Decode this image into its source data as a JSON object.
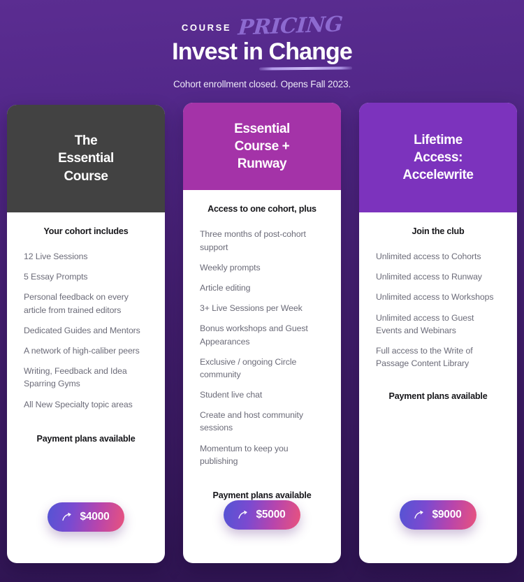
{
  "header": {
    "eyebrow_primary": "COURSE",
    "eyebrow_script": "PRICING",
    "headline": "Invest in Change",
    "subtitle": "Cohort enrollment closed. Opens Fall 2023.",
    "underline_color": "#b49ceb"
  },
  "theme": {
    "background_top": "#5b2d91",
    "background_bottom": "#2e1450",
    "cta_gradient_start": "#5454d4",
    "cta_gradient_end": "#e9537d",
    "card_body_bg": "#ffffff",
    "feature_text_color": "#6b6b78"
  },
  "plans": [
    {
      "title": "The Essential Course",
      "title_lines": [
        "The",
        "Essential",
        "Course"
      ],
      "header_color": "#424242",
      "subhead": "Your cohort includes",
      "features": [
        "12 Live Sessions",
        "5 Essay Prompts",
        "Personal feedback on every article from trained editors",
        "Dedicated Guides and Mentors",
        "A network of high-caliber peers",
        "Writing, Feedback and Idea Sparring Gyms",
        "All New Specialty topic areas"
      ],
      "payment_note": "Payment plans available",
      "price_label": "$4000",
      "cta_icon": "curved-arrow-icon"
    },
    {
      "title": "Essential Course + Runway",
      "title_lines": [
        "Essential",
        "Course +",
        "Runway"
      ],
      "header_color": "#a433a8",
      "subhead": "Access to one cohort, plus",
      "features": [
        "Three months of post-cohort support",
        "Weekly prompts",
        "Article editing",
        "3+ Live Sessions per Week",
        "Bonus workshops and Guest Appearances",
        "Exclusive / ongoing Circle community",
        "Student live chat",
        "Create and host community sessions",
        "Momentum to keep you publishing"
      ],
      "payment_note": "Payment plans available",
      "price_label": "$5000",
      "cta_icon": "curved-arrow-icon"
    },
    {
      "title": "Lifetime Access: Accelewrite",
      "title_lines": [
        "Lifetime",
        "Access:",
        "Accelewrite"
      ],
      "header_color": "#7c33bd",
      "subhead": "Join the club",
      "features": [
        "Unlimited access to Cohorts",
        "Unlimited access to Runway",
        "Unlimited access to Workshops",
        "Unlimited access to Guest Events and Webinars",
        "Full access to the Write of Passage Content Library"
      ],
      "payment_note": "Payment plans available",
      "price_label": "$9000",
      "cta_icon": "curved-arrow-icon"
    }
  ]
}
